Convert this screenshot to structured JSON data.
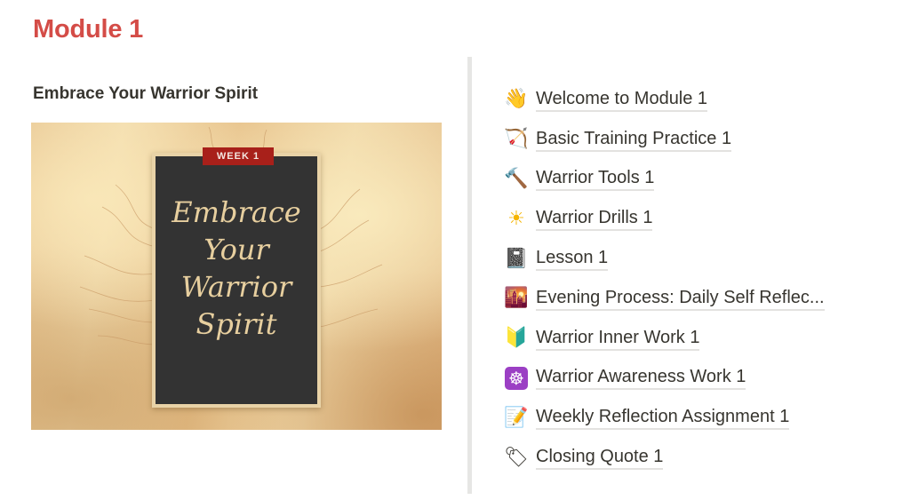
{
  "page": {
    "title": "Module 1",
    "title_color": "#d44c47"
  },
  "left": {
    "heading": "Embrace Your Warrior Spirit",
    "cover": {
      "badge": "WEEK 1",
      "badge_color": "#a8201a",
      "script_lines": [
        "Embrace",
        "Your",
        "Warrior",
        "Spirit"
      ]
    }
  },
  "links": [
    {
      "icon": "waving-hand-icon",
      "glyph": "👋",
      "label": "Welcome to Module 1"
    },
    {
      "icon": "bow-and-arrow-icon",
      "glyph": "🏹",
      "label": "Basic Training Practice 1"
    },
    {
      "icon": "hammer-icon",
      "glyph": "🔨",
      "label": "Warrior Tools 1"
    },
    {
      "icon": "sun-icon",
      "glyph": "☀",
      "label": "Warrior Drills 1"
    },
    {
      "icon": "notebook-icon",
      "glyph": "📓",
      "label": "Lesson 1"
    },
    {
      "icon": "city-sunset-icon",
      "glyph": "🌇",
      "label": "Evening Process: Daily Self Reflec..."
    },
    {
      "icon": "beginner-symbol-icon",
      "glyph": "🔰",
      "label": "Warrior Inner Work 1"
    },
    {
      "icon": "wheel-of-dharma-icon",
      "glyph": "☸",
      "label": "Warrior Awareness Work 1"
    },
    {
      "icon": "memo-icon",
      "glyph": "📝",
      "label": "Weekly Reflection Assignment 1"
    },
    {
      "icon": "label-tag-icon",
      "glyph": "🏷",
      "label": "Closing Quote 1"
    }
  ]
}
